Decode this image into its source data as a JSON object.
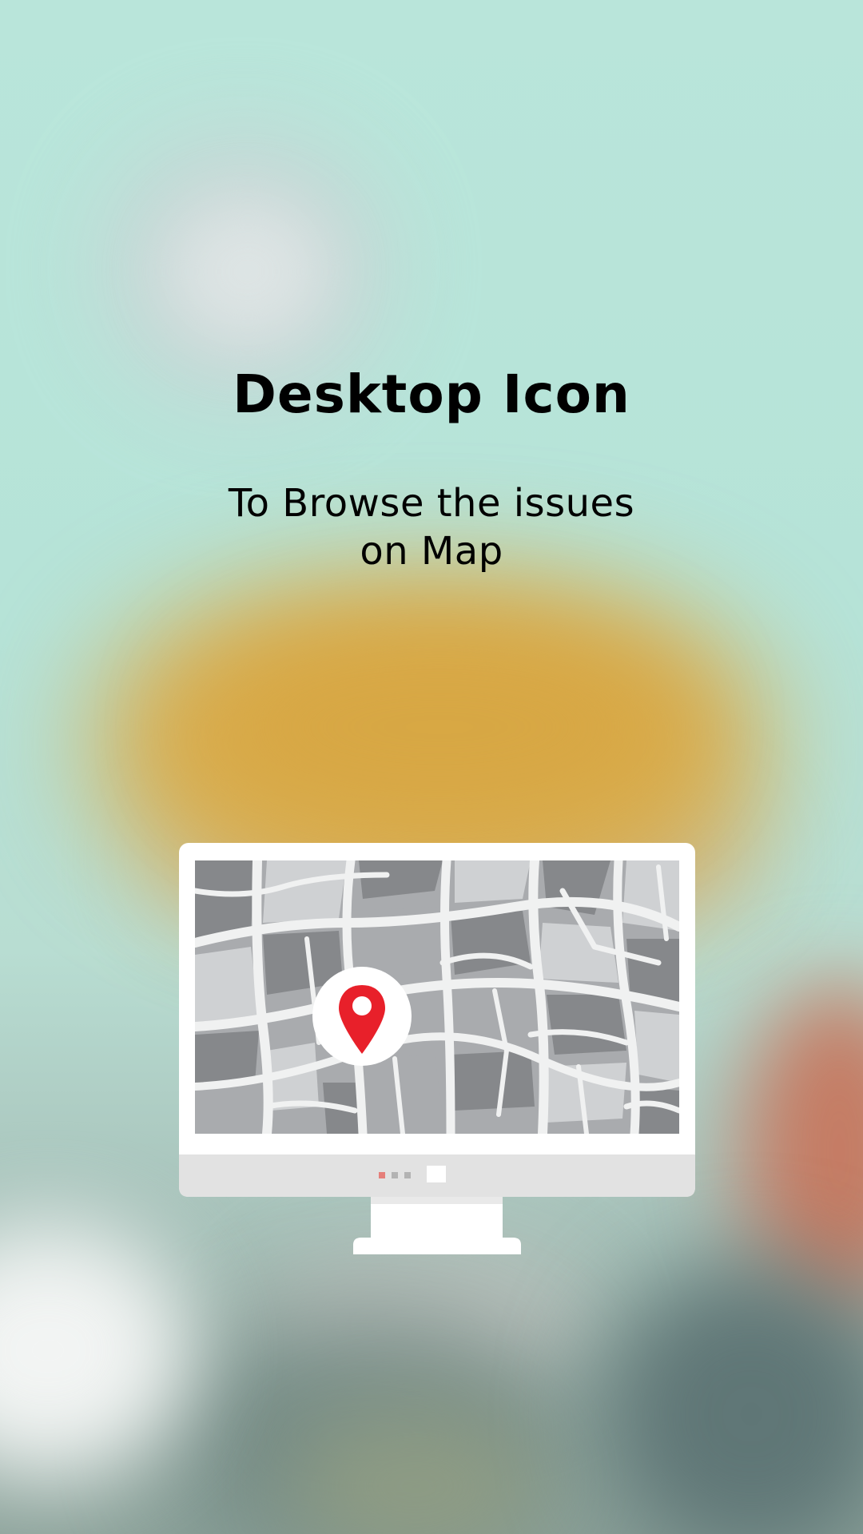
{
  "screen": {
    "title": "Desktop Icon",
    "subtitle_lines": [
      "To Browse the issues",
      "on Map"
    ]
  },
  "illustration": {
    "icon_name": "desktop-map-icon",
    "pin_icon_name": "map-pin-icon",
    "colors": {
      "pin": "#e8202a",
      "frame": "#ffffff",
      "bezel": "#e2e2e2",
      "roads": "#f0f1f1",
      "block_dark": "#86888b",
      "block_mid": "#a9abae",
      "block_light": "#cfd1d3"
    }
  }
}
